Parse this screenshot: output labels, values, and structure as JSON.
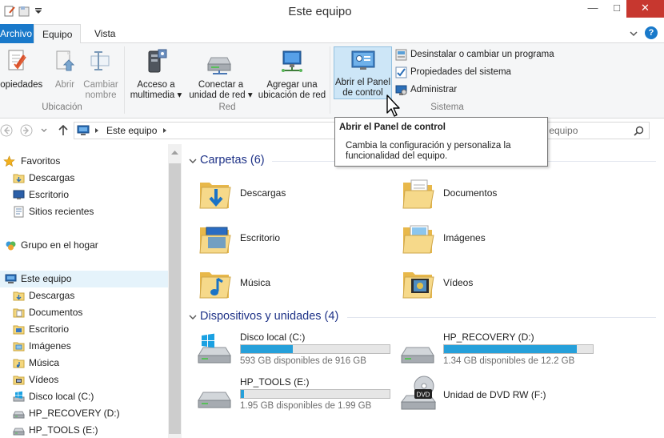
{
  "window": {
    "title": "Este equipo"
  },
  "ribbon": {
    "tabs": [
      "Archivo",
      "Equipo",
      "Vista"
    ],
    "location_group": {
      "label": "Ubicación",
      "buttons": [
        "Propiedades",
        "Abrir",
        "Cambiar\nnombre"
      ]
    },
    "network_group": {
      "label": "Red",
      "buttons": [
        "Acceso a\nmultimedia ▾",
        "Conectar a\nunidad de red ▾",
        "Agregar una\nubicación de red"
      ]
    },
    "system_group": {
      "label": "Sistema",
      "large_button": "Abrir el Panel\nde control",
      "small_items": [
        "Desinstalar o cambiar un programa",
        "Propiedades del sistema",
        "Administrar"
      ]
    }
  },
  "addressbar": {
    "path": "Este equipo",
    "search_placeholder": "Buscar en Este equipo",
    "search_visible_text": "r equipo"
  },
  "tooltip": {
    "title": "Abrir el Panel de control",
    "body": "Cambia la configuración y personaliza la funcionalidad del equipo."
  },
  "nav": {
    "favorites": "Favoritos",
    "favorites_items": [
      "Descargas",
      "Escritorio",
      "Sitios recientes"
    ],
    "homegroup": "Grupo en el hogar",
    "this_pc": "Este equipo",
    "pc_items": [
      "Descargas",
      "Documentos",
      "Escritorio",
      "Imágenes",
      "Música",
      "Vídeos",
      "Disco local (C:)",
      "HP_RECOVERY (D:)",
      "HP_TOOLS (E:)"
    ]
  },
  "content": {
    "folders_header": "Carpetas (6)",
    "folders": [
      "Descargas",
      "Documentos",
      "Escritorio",
      "Imágenes",
      "Música",
      "Vídeos"
    ],
    "devices_header": "Dispositivos y unidades (4)",
    "drives": [
      {
        "name": "Disco local (C:)",
        "info": "593 GB disponibles de 916 GB",
        "used_fraction": 0.35
      },
      {
        "name": "HP_RECOVERY (D:)",
        "info": "1.34 GB disponibles de 12.2 GB",
        "used_fraction": 0.89
      },
      {
        "name": "HP_TOOLS (E:)",
        "info": "1.95 GB disponibles de 1.99 GB",
        "used_fraction": 0.02
      },
      {
        "name": "Unidad de DVD RW (F:)"
      }
    ]
  },
  "colors": {
    "accent": "#1979ca",
    "header_text": "#1e3287",
    "drive_bar": "#26a0da"
  }
}
